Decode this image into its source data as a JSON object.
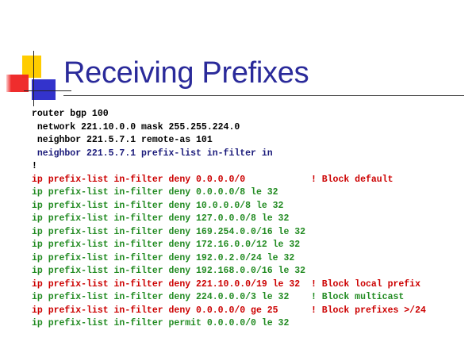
{
  "slide": {
    "title": "Receiving Prefixes",
    "colors": {
      "title": "#2a2a9a",
      "black": "#000000",
      "navy": "#1a1a7a",
      "red": "#cc0000",
      "green": "#228b22",
      "logo_yellow": "#ffcc00",
      "logo_red": "#ee2222",
      "logo_blue": "#3333cc"
    },
    "code_lines": [
      {
        "text": "router bgp 100",
        "color": "black"
      },
      {
        "text": " network 221.10.0.0 mask 255.255.224.0",
        "color": "black"
      },
      {
        "text": " neighbor 221.5.7.1 remote-as 101",
        "color": "black"
      },
      {
        "text": " neighbor 221.5.7.1 prefix-list in-filter in",
        "color": "navy"
      },
      {
        "text": "!",
        "color": "black"
      },
      {
        "text": "ip prefix-list in-filter deny 0.0.0.0/0            ! Block default",
        "color": "red"
      },
      {
        "text": "ip prefix-list in-filter deny 0.0.0.0/8 le 32",
        "color": "green"
      },
      {
        "text": "ip prefix-list in-filter deny 10.0.0.0/8 le 32",
        "color": "green"
      },
      {
        "text": "ip prefix-list in-filter deny 127.0.0.0/8 le 32",
        "color": "green"
      },
      {
        "text": "ip prefix-list in-filter deny 169.254.0.0/16 le 32",
        "color": "green"
      },
      {
        "text": "ip prefix-list in-filter deny 172.16.0.0/12 le 32",
        "color": "green"
      },
      {
        "text": "ip prefix-list in-filter deny 192.0.2.0/24 le 32",
        "color": "green"
      },
      {
        "text": "ip prefix-list in-filter deny 192.168.0.0/16 le 32",
        "color": "green"
      },
      {
        "text": "ip prefix-list in-filter deny 221.10.0.0/19 le 32  ! Block local prefix",
        "color": "red"
      },
      {
        "text": "ip prefix-list in-filter deny 224.0.0.0/3 le 32    ! Block multicast",
        "color": "green"
      },
      {
        "text": "ip prefix-list in-filter deny 0.0.0.0/0 ge 25      ! Block prefixes >/24",
        "color": "red"
      },
      {
        "text": "ip prefix-list in-filter permit 0.0.0.0/0 le 32",
        "color": "green"
      }
    ]
  }
}
